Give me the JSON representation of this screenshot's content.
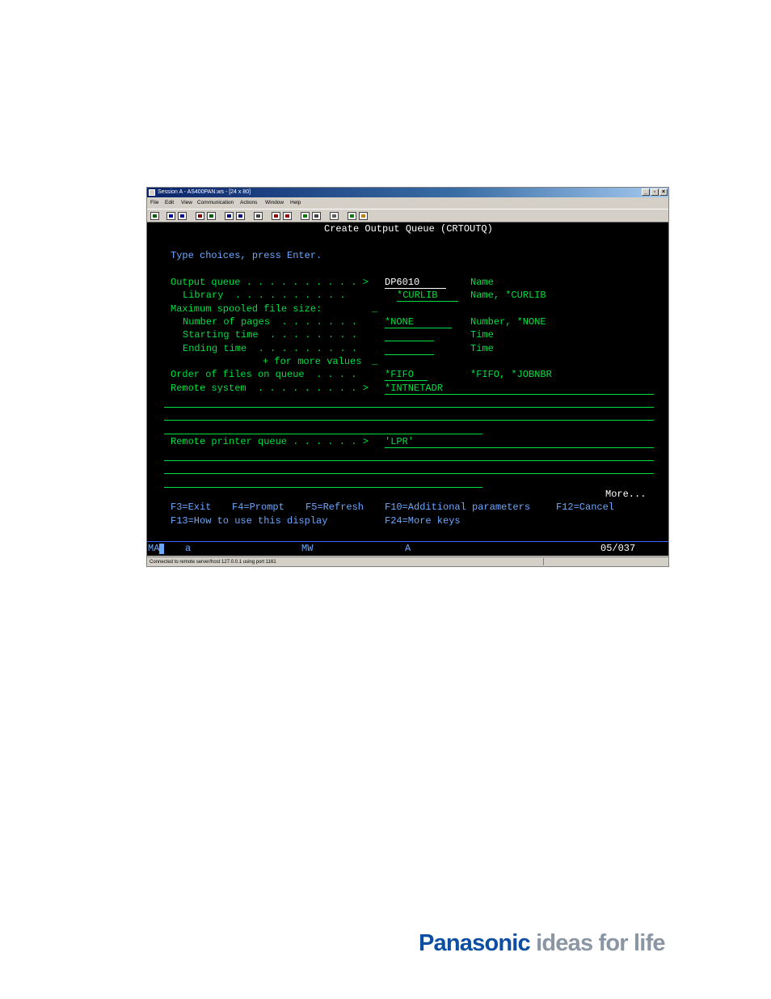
{
  "window": {
    "title": "Session A - AS400PAN.ws - [24 x 80]",
    "controls": {
      "minimize": "_",
      "restore": "▫",
      "close": "×"
    }
  },
  "menubar": [
    "File",
    "Edit",
    "View",
    "Communication",
    "Actions",
    "Window",
    "Help"
  ],
  "toolbar": {
    "icons": [
      "print-icon",
      "copy-icon",
      "paste-icon",
      "send-icon",
      "receive-icon",
      "display-icon",
      "keypad-icon",
      "macro-icon",
      "record-icon",
      "stop-icon",
      "play-icon",
      "clear-icon",
      "settings-icon",
      "globe-icon",
      "edit-icon"
    ],
    "colors": [
      "#006400",
      "#0000a0",
      "#0000a0",
      "#800000",
      "#006400",
      "#000080",
      "#000080",
      "#404040",
      "#a00000",
      "#a00000",
      "#008000",
      "#404040",
      "#606060",
      "#008000",
      "#c08000"
    ]
  },
  "terminal": {
    "title": "Create Output Queue (CRTOUTQ)",
    "instruction": "Type choices, press Enter.",
    "fields": {
      "output_queue": {
        "label": "Output queue . . . . . . . . . . >",
        "value": "DP6010",
        "help": "Name"
      },
      "library": {
        "label": "Library  . . . . . . . . . .",
        "value": "*CURLIB",
        "help": "Name, *CURLIB"
      },
      "max_size": {
        "label": "Maximum spooled file size:",
        "value": "_"
      },
      "pages": {
        "label": "Number of pages  . . . . . . .",
        "value": "*NONE",
        "help": "Number, *NONE"
      },
      "start_time": {
        "label": "Starting time  . . . . . . . .",
        "value": "",
        "help": "Time"
      },
      "end_time": {
        "label": "Ending time  . . . . . . . . .",
        "value": "",
        "help": "Time"
      },
      "more_values": {
        "label": "+ for more values",
        "value": "_"
      },
      "order": {
        "label": "Order of files on queue  . . . .",
        "value": "*FIFO",
        "help": "*FIFO, *JOBNBR"
      },
      "remote_system": {
        "label": "Remote system  . . . . . . . . . >",
        "value": "*INTNETADR"
      },
      "remote_printer_queue": {
        "label": "Remote printer queue . . . . . . >",
        "value": "'LPR'"
      }
    },
    "more": "More...",
    "fkeys_row1": [
      "F3=Exit",
      "F4=Prompt",
      "F5=Refresh",
      "F10=Additional parameters",
      "F12=Cancel"
    ],
    "fkeys_row2": [
      "F13=How to use this display",
      "F24=More keys"
    ]
  },
  "oia": {
    "indicator": "MA",
    "session": "a",
    "mode": "MW",
    "field": "A",
    "cursor_pos": "05/037"
  },
  "statusbar": {
    "text": "Connected to remote server/host 127.0.0.1 using port 1161"
  },
  "logo": {
    "brand": "Panasonic",
    "tagline": "ideas for life",
    "colors": {
      "brand": "#0b4ea2",
      "tagline": "#8a96a3"
    }
  }
}
